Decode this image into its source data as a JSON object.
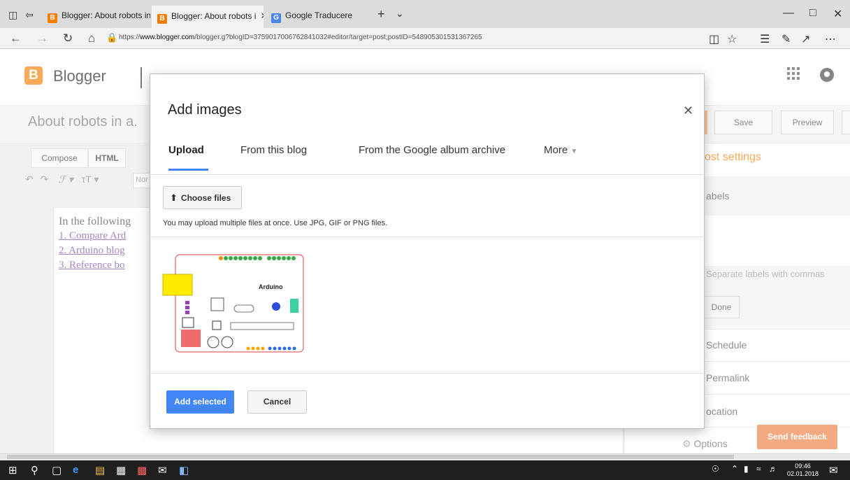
{
  "browser": {
    "tabs": [
      {
        "title": "Blogger: About robots in a c",
        "favicon": "B"
      },
      {
        "title": "Blogger: About robots i",
        "favicon": "B"
      },
      {
        "title": "Google Traducere",
        "favicon": "G"
      }
    ],
    "url_prefix": "https://",
    "url_host": "www.blogger.com",
    "url_rest": "/blogger.g?blogID=3759017006762841032#editor/target=post;postID=548905301531367265"
  },
  "blogger": {
    "logo_letter": "B",
    "brand": "Blogger",
    "post_title": "About robots in a.",
    "save_label": "Save",
    "preview_label": "Preview",
    "compose_label": "Compose",
    "html_label": "HTML",
    "font_select_value": "Nor",
    "editor_intro": "In the following",
    "editor_items": [
      "1. Compare Ard",
      "2. Arduino blog",
      "3. Reference bo"
    ],
    "post_settings_title": "ost settings",
    "labels_title": "abels",
    "labels_placeholder": "Separate labels with commas",
    "done_label": "Done",
    "schedule_label": "Schedule",
    "permalink_label": "Permalink",
    "location_label": "ocation",
    "options_label": "Options",
    "feedback_label": "Send feedback"
  },
  "dialog": {
    "title": "Add images",
    "tabs": [
      "Upload",
      "From this blog",
      "From the Google album archive",
      "More"
    ],
    "choose_files_label": "Choose files",
    "upload_hint": "You may upload multiple files at once. Use JPG, GIF or PNG files.",
    "thumbnail_text": "Arduino",
    "add_selected_label": "Add selected",
    "cancel_label": "Cancel"
  },
  "taskbar": {
    "time": "09:46",
    "date": "02.01.2018"
  },
  "colors": {
    "blogger_orange": "#f57d00",
    "primary_blue": "#4285f4",
    "feedback_orange": "#ef7d3c"
  }
}
